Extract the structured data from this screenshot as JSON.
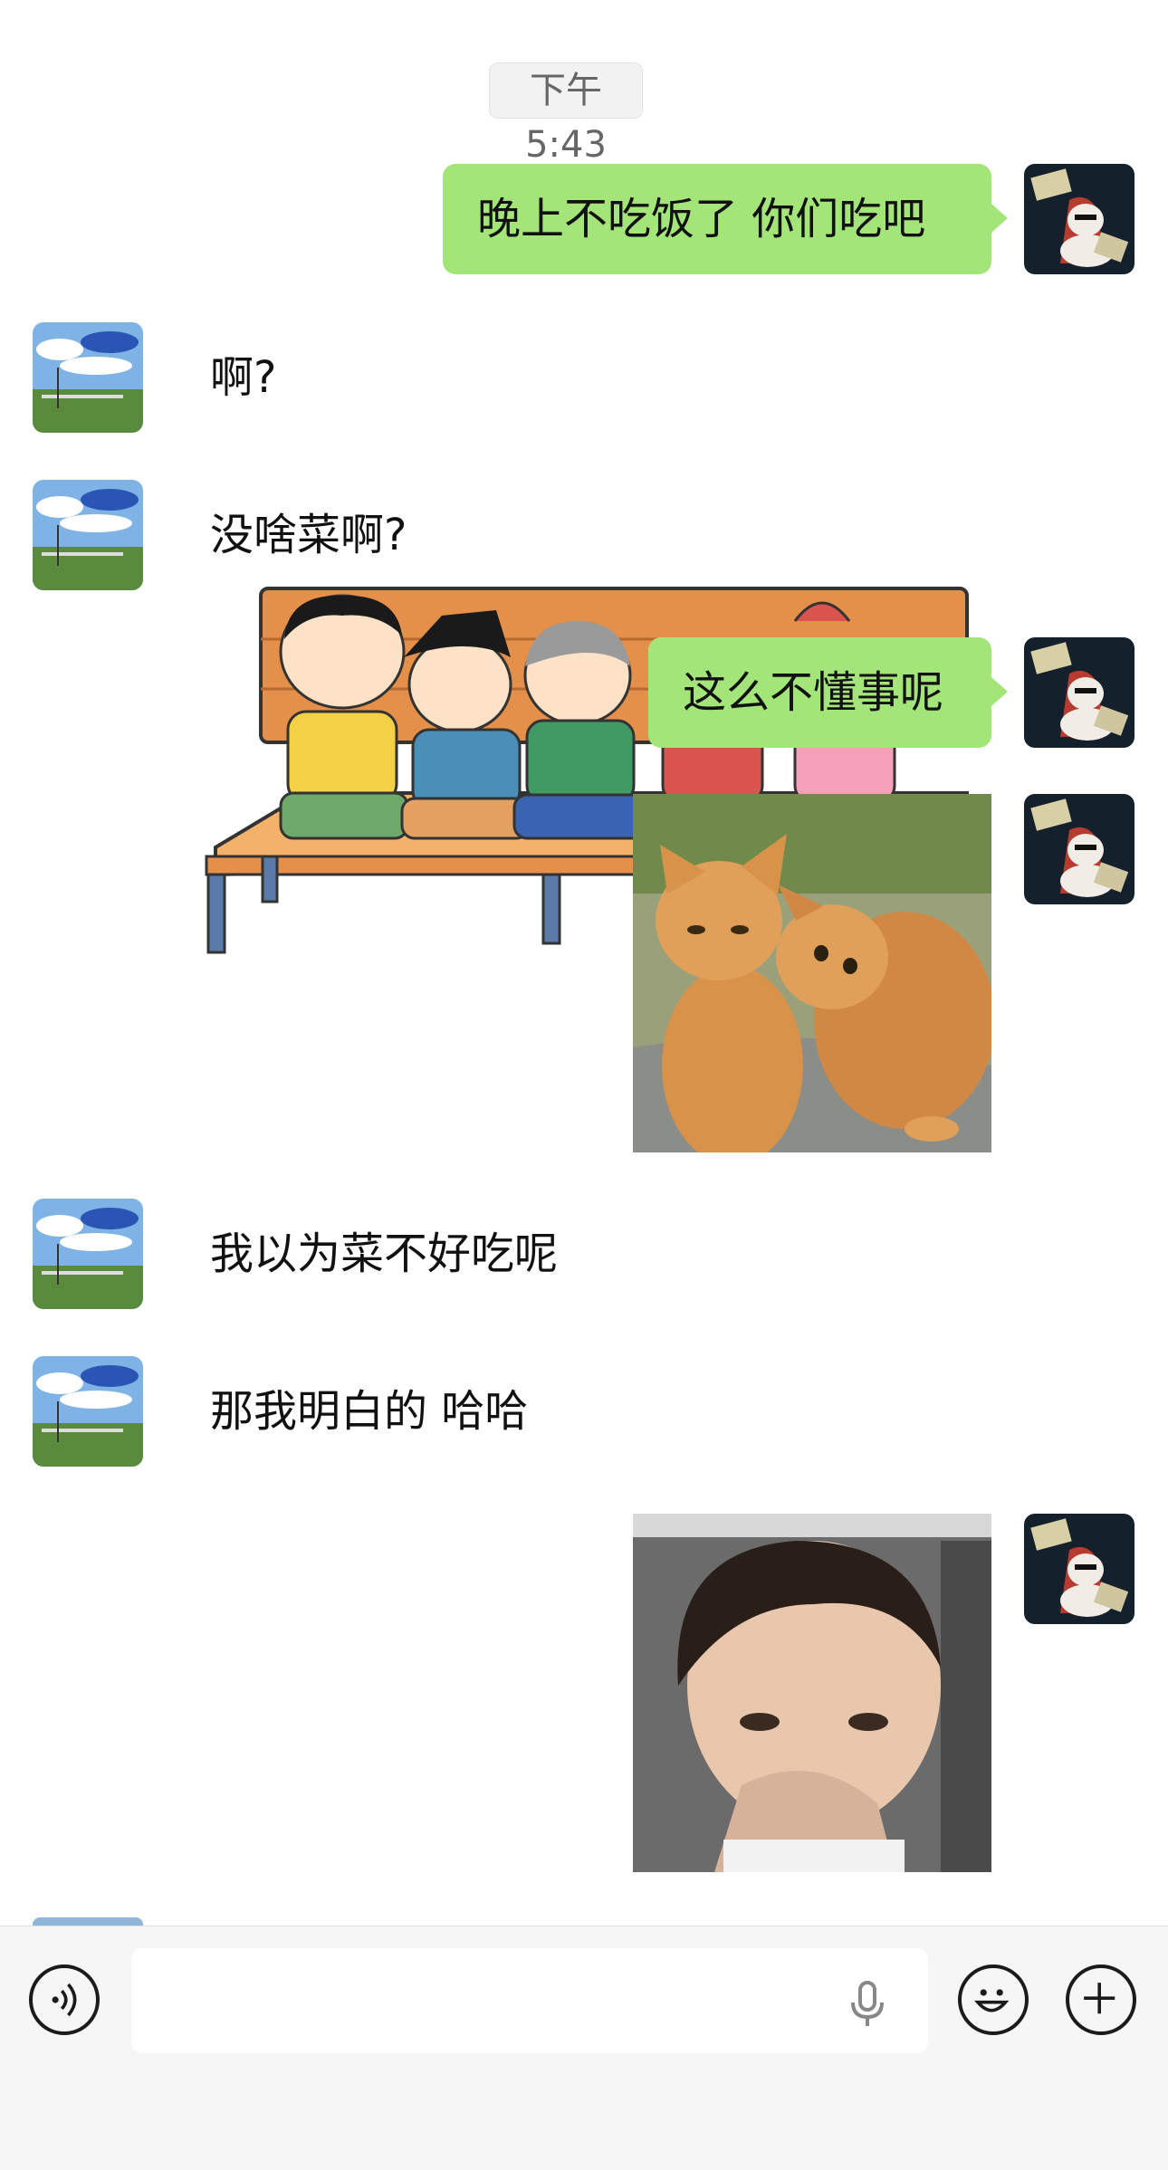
{
  "timestamp": "下午 5:43",
  "messages": [
    {
      "side": "out",
      "type": "text",
      "text": "晚上不吃饭了 你们吃吧"
    },
    {
      "side": "in",
      "type": "text",
      "text": "啊?"
    },
    {
      "side": "in",
      "type": "text",
      "text": "没啥菜啊?"
    },
    {
      "side": "in",
      "type": "sticker",
      "description": "cartoon kids sleeping on bench sticker"
    },
    {
      "side": "out",
      "type": "text",
      "text": "这么不懂事呢"
    },
    {
      "side": "out",
      "type": "sticker",
      "description": "two orange cats sticker"
    },
    {
      "side": "in",
      "type": "text",
      "text": "我以为菜不好吃呢"
    },
    {
      "side": "in",
      "type": "text",
      "text": "那我明白的 哈哈"
    },
    {
      "side": "out",
      "type": "sticker",
      "description": "man touching nose sticker"
    }
  ],
  "input_bar": {
    "voice_icon": "voice-icon",
    "mic_icon": "mic-icon",
    "emoji_icon": "emoji-icon",
    "plus_icon": "plus-icon",
    "input_value": ""
  },
  "colors": {
    "outgoing_bubble": "#a4e57a",
    "background": "#ffffff",
    "input_bar": "#f6f6f6"
  }
}
